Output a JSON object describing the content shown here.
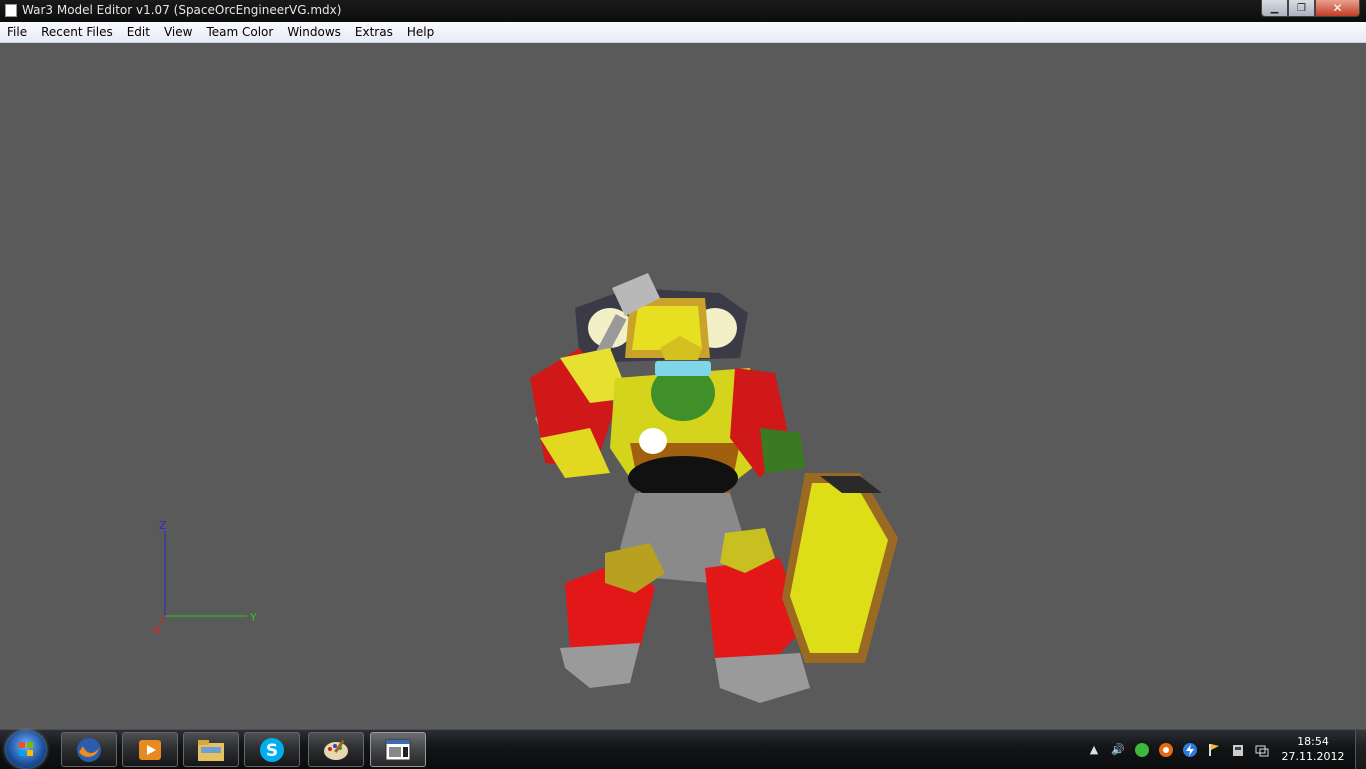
{
  "window": {
    "title": "War3 Model Editor v1.07 (SpaceOrcEngineerVG.mdx)",
    "min_glyph": "▁",
    "max_glyph": "❐",
    "close_glyph": "✕"
  },
  "menu": [
    "File",
    "Recent Files",
    "Edit",
    "View",
    "Team Color",
    "Windows",
    "Extras",
    "Help"
  ],
  "viewport": {
    "background": "#5a5a5a",
    "axes": {
      "z": "Z",
      "y": "Y",
      "x": "X",
      "z_color": "#2a2ad0",
      "y_color": "#22cc22",
      "x_color": "#dd2222"
    }
  },
  "taskbar": {
    "apps": [
      {
        "name": "firefox",
        "icon": "firefox-icon"
      },
      {
        "name": "media-player",
        "icon": "media-player-icon"
      },
      {
        "name": "explorer",
        "icon": "folder-icon"
      },
      {
        "name": "skype",
        "icon": "skype-icon",
        "glyph": "S"
      },
      {
        "name": "paint",
        "icon": "paint-palette-icon"
      },
      {
        "name": "war3-model-editor",
        "icon": "model-editor-icon"
      }
    ],
    "tray": {
      "show_hidden": "▲",
      "volume": "🔊"
    },
    "time": "18:54",
    "date": "27.11.2012"
  }
}
